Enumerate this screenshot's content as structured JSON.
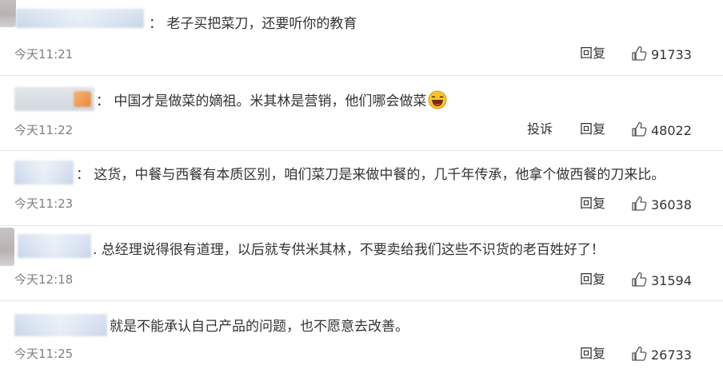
{
  "comments": [
    {
      "text": "：  老子买把菜刀，还要听你的教育",
      "time": "今天11:21",
      "actions": [
        "回复"
      ],
      "likes": "91733"
    },
    {
      "text": "：  中国才是做菜的嫡祖。米其林是营销，他们哪会做菜",
      "emoji": "laughing-emoji",
      "time": "今天11:22",
      "actions": [
        "投诉",
        "回复"
      ],
      "likes": "48022"
    },
    {
      "text": "：  这货，中餐与西餐有本质区别，咱们菜刀是来做中餐的，几千年传承，他拿个做西餐的刀来比。",
      "time": "今天11:23",
      "actions": [
        "回复"
      ],
      "likes": "36038"
    },
    {
      "text": ".  总经理说得很有道理，以后就专供米其林，不要卖给我们这些不识货的老百姓好了！",
      "time": "今天12:18",
      "actions": [
        "回复"
      ],
      "likes": "31594"
    },
    {
      "text": "就是不能承认自己产品的问题，也不愿意去改善。",
      "time": "今天11:25",
      "actions": [
        "回复"
      ],
      "likes": "26733"
    }
  ],
  "icons": {
    "like": "thumbs-up-icon"
  },
  "colors": {
    "time": "#808080",
    "divider": "#e6e6e6",
    "nameBlur": "#c8d6ea"
  }
}
